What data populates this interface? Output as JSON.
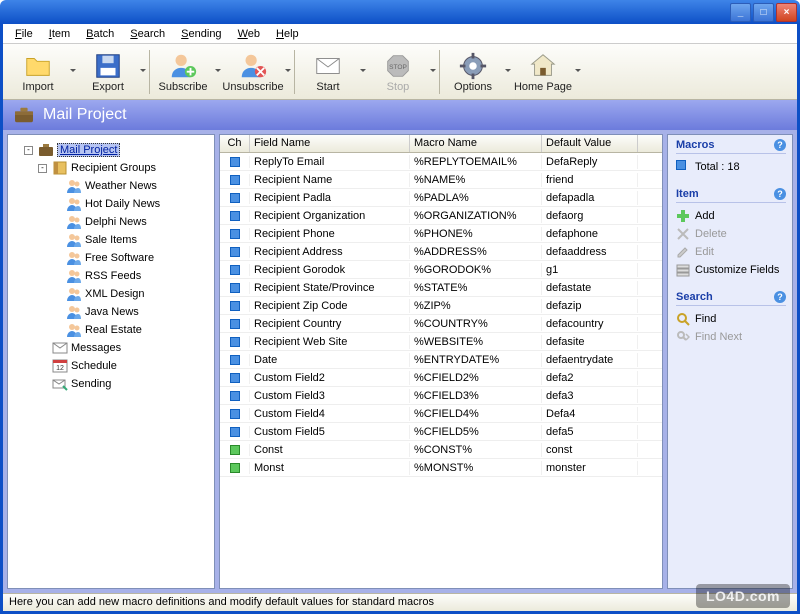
{
  "window": {
    "title": ""
  },
  "menu": [
    "File",
    "Item",
    "Batch",
    "Search",
    "Sending",
    "Web",
    "Help"
  ],
  "toolbar": [
    {
      "label": "Import",
      "icon": "folder"
    },
    {
      "label": "Export",
      "icon": "floppy"
    },
    {
      "label": "Subscribe",
      "icon": "user-add"
    },
    {
      "label": "Unsubscribe",
      "icon": "user-remove"
    },
    {
      "label": "Start",
      "icon": "envelope"
    },
    {
      "label": "Stop",
      "icon": "stop",
      "disabled": true
    },
    {
      "label": "Options",
      "icon": "gear"
    },
    {
      "label": "Home Page",
      "icon": "home"
    }
  ],
  "header": {
    "title": "Mail Project",
    "icon": "briefcase"
  },
  "tree": {
    "root": {
      "label": "Mail Project",
      "icon": "briefcase",
      "selected": true
    },
    "recipient_groups": {
      "label": "Recipient Groups",
      "icon": "book",
      "children": [
        "Weather News",
        "Hot Daily News",
        "Delphi News",
        "Sale Items",
        "Free Software",
        "RSS Feeds",
        "XML Design",
        "Java News",
        "Real Estate"
      ]
    },
    "other": [
      {
        "label": "Messages",
        "icon": "message"
      },
      {
        "label": "Schedule",
        "icon": "calendar"
      },
      {
        "label": "Sending",
        "icon": "sending"
      }
    ]
  },
  "table": {
    "columns": [
      "Ch",
      "Field Name",
      "Macro Name",
      "Default Value"
    ],
    "rows": [
      {
        "ch": "blue",
        "fn": "ReplyTo Email",
        "mn": "%REPLYTOEMAIL%",
        "dv": "DefaReply"
      },
      {
        "ch": "blue",
        "fn": "Recipient Name",
        "mn": "%NAME%",
        "dv": "friend"
      },
      {
        "ch": "blue",
        "fn": "Recipient Padla",
        "mn": "%PADLA%",
        "dv": "defapadla"
      },
      {
        "ch": "blue",
        "fn": "Recipient Organization",
        "mn": "%ORGANIZATION%",
        "dv": "defaorg"
      },
      {
        "ch": "blue",
        "fn": "Recipient Phone",
        "mn": "%PHONE%",
        "dv": "defaphone"
      },
      {
        "ch": "blue",
        "fn": "Recipient Address",
        "mn": "%ADDRESS%",
        "dv": "defaaddress"
      },
      {
        "ch": "blue",
        "fn": "Recipient Gorodok",
        "mn": "%GORODOK%",
        "dv": "g1"
      },
      {
        "ch": "blue",
        "fn": "Recipient State/Province",
        "mn": "%STATE%",
        "dv": "defastate"
      },
      {
        "ch": "blue",
        "fn": "Recipient Zip Code",
        "mn": "%ZIP%",
        "dv": "defazip"
      },
      {
        "ch": "blue",
        "fn": "Recipient Country",
        "mn": "%COUNTRY%",
        "dv": "defacountry"
      },
      {
        "ch": "blue",
        "fn": "Recipient Web Site",
        "mn": "%WEBSITE%",
        "dv": "defasite"
      },
      {
        "ch": "blue",
        "fn": "Date",
        "mn": "%ENTRYDATE%",
        "dv": "defaentrydate"
      },
      {
        "ch": "blue",
        "fn": "Custom Field2",
        "mn": "%CFIELD2%",
        "dv": "defa2"
      },
      {
        "ch": "blue",
        "fn": "Custom Field3",
        "mn": "%CFIELD3%",
        "dv": "defa3"
      },
      {
        "ch": "blue",
        "fn": "Custom Field4",
        "mn": "%CFIELD4%",
        "dv": "Defa4"
      },
      {
        "ch": "blue",
        "fn": "Custom Field5",
        "mn": "%CFIELD5%",
        "dv": "defa5"
      },
      {
        "ch": "green",
        "fn": "Const",
        "mn": "%CONST%",
        "dv": "const"
      },
      {
        "ch": "green",
        "fn": "Monst",
        "mn": "%MONST%",
        "dv": "monster"
      }
    ]
  },
  "side": {
    "macros": {
      "title": "Macros",
      "items": [
        {
          "label": "Total : 18",
          "icon": "sq-blue"
        }
      ]
    },
    "item": {
      "title": "Item",
      "items": [
        {
          "label": "Add",
          "icon": "plus"
        },
        {
          "label": "Delete",
          "icon": "delete",
          "disabled": true
        },
        {
          "label": "Edit",
          "icon": "edit",
          "disabled": true
        },
        {
          "label": "Customize Fields",
          "icon": "fields"
        }
      ]
    },
    "search": {
      "title": "Search",
      "items": [
        {
          "label": "Find",
          "icon": "find"
        },
        {
          "label": "Find Next",
          "icon": "find-next",
          "disabled": true
        }
      ]
    }
  },
  "status": "Here you can add new macro definitions and modify default values for standard macros",
  "watermark": "LO4D.com"
}
